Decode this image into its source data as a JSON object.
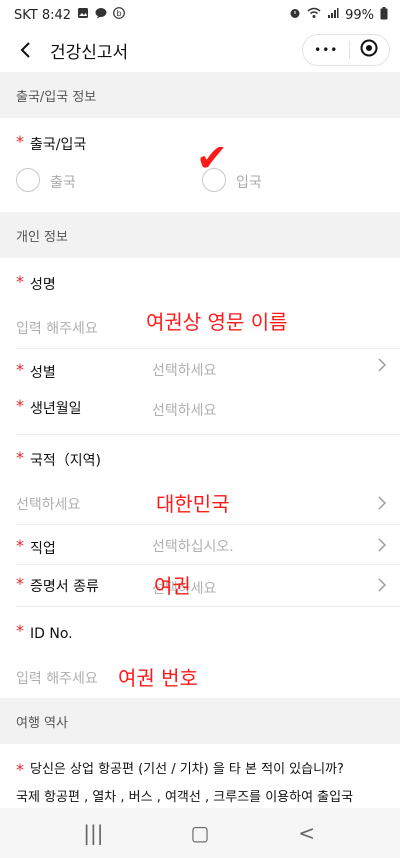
{
  "status_bar": {
    "carrier_time": "SKT 8:42",
    "battery": "99%"
  },
  "nav": {
    "title": "건강신고서",
    "more_label": "•••"
  },
  "sections": {
    "entry": {
      "header": "출국/입국 정보",
      "label": "출국/입국",
      "options": [
        "출국",
        "입국"
      ]
    },
    "personal": {
      "header": "개인 정보",
      "name_label": "성명",
      "name_placeholder": "입력 해주세요",
      "gender_label": "성별",
      "gender_placeholder": "선택하세요",
      "birth_label": "생년월일",
      "birth_placeholder": "선택하세요",
      "nationality_label": "국적（지역)",
      "nationality_placeholder": "선택하세요",
      "job_label": "직업",
      "job_placeholder": "선택하십시오.",
      "cert_label": "증명서 종류",
      "cert_placeholder": "선택하세요",
      "id_label": "ID No.",
      "id_placeholder": "입력 해주세요"
    },
    "travel": {
      "header": "여행 역사",
      "question_line1": "당신은 상업 항공편 (기선 / 기차) 을 타 본 적이 있습니까?",
      "question_line2": "국제 항공편 , 열차 , 버스 , 여객선 , 크루즈를 이용하여 출입국"
    }
  },
  "annotations": {
    "name_note": "여권상 영문 이름",
    "nationality_note": "대한민국",
    "cert_note": "여권",
    "id_note": "여권 번호",
    "checkmark": "✔"
  },
  "bottom_nav": {
    "recents": "|||",
    "home": "▢",
    "back": "<"
  }
}
